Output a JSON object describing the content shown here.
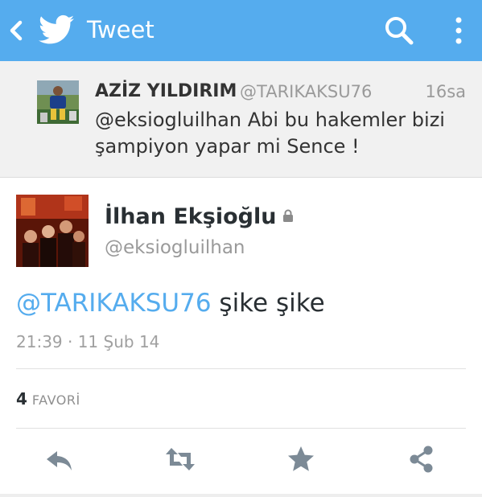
{
  "header": {
    "title": "Tweet",
    "background": "#55acee",
    "icons": [
      "back-arrow-icon",
      "twitter-bird-icon",
      "search-icon",
      "overflow-menu-icon"
    ]
  },
  "parent_tweet": {
    "name": "AZİZ YILDIRIM",
    "handle": "@TARIKAKSU76",
    "time": "16sa",
    "text": "@eksiogluilhan Abi bu hakemler bizi şampiyon yapar mi Sence !"
  },
  "main_tweet": {
    "name": "İlhan Ekşioğlu",
    "handle": "@eksiogluilhan",
    "mention": "@TARIKAKSU76",
    "text": " şike şike",
    "timestamp": "21:39 · 11 Şub 14",
    "favorites_count": "4",
    "favorites_label": "FAVORİ",
    "link_color": "#55acee"
  },
  "actions": [
    "reply-icon",
    "retweet-icon",
    "favorite-star-icon",
    "share-icon"
  ]
}
